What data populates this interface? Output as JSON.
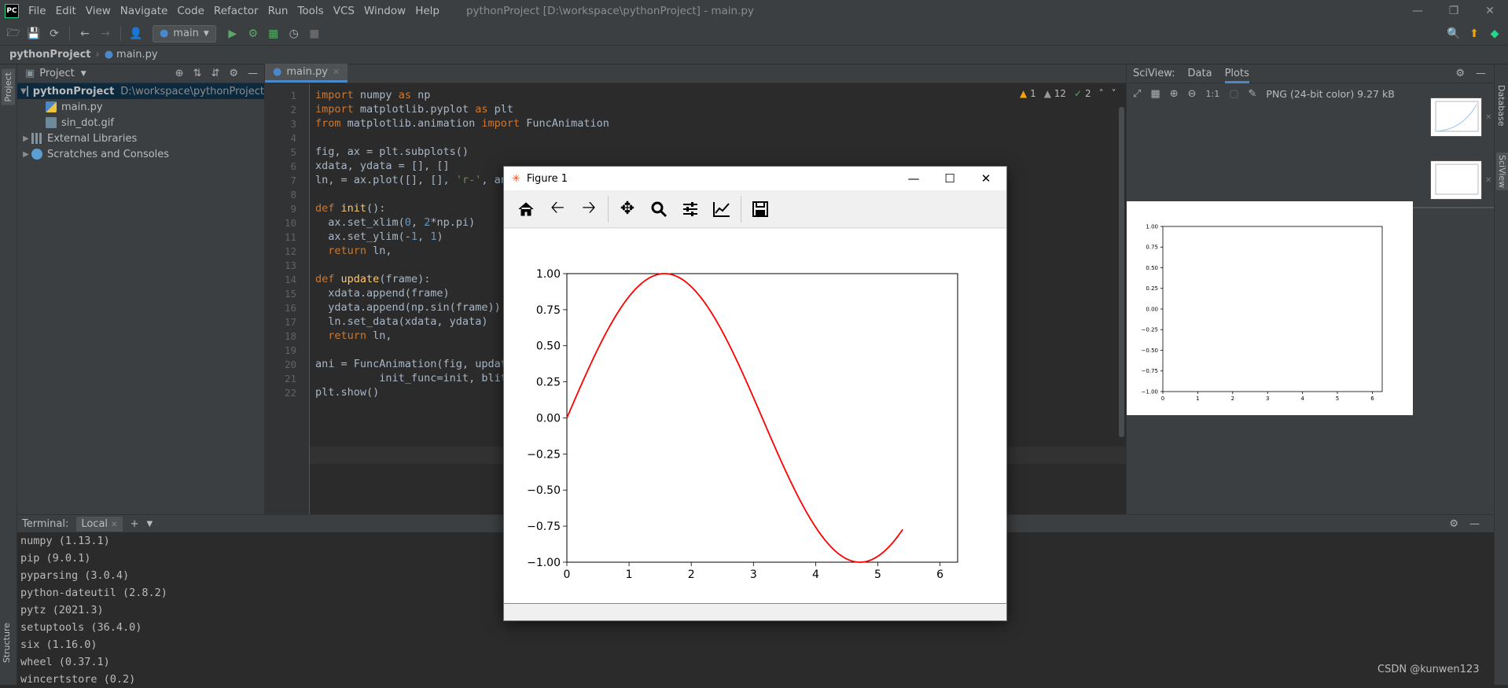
{
  "menubar": {
    "logo": "PC",
    "items": [
      "File",
      "Edit",
      "View",
      "Navigate",
      "Code",
      "Refactor",
      "Run",
      "Tools",
      "VCS",
      "Window",
      "Help"
    ],
    "window_title": "pythonProject [D:\\workspace\\pythonProject] - main.py"
  },
  "toolbar": {
    "run_config": "main"
  },
  "breadcrumb": {
    "project": "pythonProject",
    "file": "main.py"
  },
  "project_panel": {
    "title": "Project",
    "tree": [
      {
        "label": "pythonProject",
        "path": "D:\\workspace\\pythonProject",
        "level": 0,
        "icon": "folder-icon"
      },
      {
        "label": "main.py",
        "level": 1,
        "icon": "python-file-icon"
      },
      {
        "label": "sin_dot.gif",
        "level": 1,
        "icon": "image-file-icon"
      },
      {
        "label": "External Libraries",
        "level": 0,
        "icon": "library-icon"
      },
      {
        "label": "Scratches and Consoles",
        "level": 0,
        "icon": "scratches-icon"
      }
    ]
  },
  "left_strip": {
    "project_label": "Project",
    "structure_label": "Structure"
  },
  "editor": {
    "tab": "main.py",
    "inspections": {
      "warnings": "1",
      "weak_warnings": "12",
      "ok": "2"
    },
    "line_numbers": [
      "1",
      "2",
      "3",
      "4",
      "5",
      "6",
      "7",
      "8",
      "9",
      "10",
      "11",
      "12",
      "13",
      "14",
      "15",
      "16",
      "17",
      "18",
      "19",
      "20",
      "21",
      "22"
    ],
    "lines": [
      "import numpy as np",
      "import matplotlib.pyplot as plt",
      "from matplotlib.animation import FuncAnimation",
      "",
      "fig, ax = plt.subplots()",
      "xdata, ydata = [], []",
      "ln, = ax.plot([], [], 'r-', an",
      "",
      "def init():",
      "  ax.set_xlim(0, 2*np.pi)",
      "  ax.set_ylim(-1, 1)",
      "  return ln,",
      "",
      "def update(frame):",
      "  xdata.append(frame)",
      "  ydata.append(np.sin(frame))",
      "  ln.set_data(xdata, ydata)",
      "  return ln,",
      "",
      "ani = FuncAnimation(fig, updat",
      "          init_func=init, blit",
      "plt.show()"
    ]
  },
  "sciview": {
    "title": "SciView:",
    "tabs": [
      "Data",
      "Plots"
    ],
    "image_info": "PNG (24-bit color) 9.27 kB",
    "zoom_label": "1:1",
    "preview": {
      "y_ticks": [
        "1.00",
        "0.75",
        "0.50",
        "0.25",
        "0.00",
        "−0.25",
        "−0.50",
        "−0.75",
        "−1.00"
      ],
      "x_ticks": [
        "0",
        "1",
        "2",
        "3",
        "4",
        "5",
        "6"
      ]
    }
  },
  "right_strip": {
    "database_label": "Database",
    "sciview_label": "SciView"
  },
  "terminal": {
    "title": "Terminal:",
    "tab": "Local",
    "lines": [
      "numpy (1.13.1)",
      "pip (9.0.1)",
      "pyparsing (3.0.4)",
      "python-dateutil (2.8.2)",
      "pytz (2021.3)",
      "setuptools (36.4.0)",
      "six (1.16.0)",
      "wheel (0.37.1)",
      "wincertstore (0.2)"
    ]
  },
  "figure_window": {
    "title": "Figure 1"
  },
  "chart_data": {
    "type": "line",
    "title": "",
    "xlabel": "",
    "ylabel": "",
    "xlim": [
      0,
      6.2832
    ],
    "ylim": [
      -1,
      1
    ],
    "x_ticks": [
      "0",
      "1",
      "2",
      "3",
      "4",
      "5",
      "6"
    ],
    "y_ticks": [
      "1.00",
      "0.75",
      "0.50",
      "0.25",
      "0.00",
      "−0.25",
      "−0.50",
      "−0.75",
      "−1.00"
    ],
    "series": [
      {
        "color": "#ff0000",
        "x_start": 0,
        "x_end": 5.4,
        "function": "sin(x)"
      }
    ],
    "grid": false
  },
  "colors": {
    "keyword": "#cc7832",
    "number": "#6897bb",
    "string": "#6a8759",
    "function": "#ffc66d",
    "accent": "#4a88c7"
  },
  "watermark": "CSDN @kunwen123"
}
